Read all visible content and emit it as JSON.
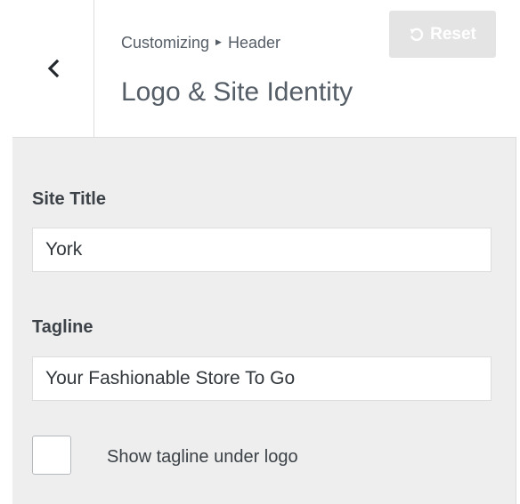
{
  "header": {
    "breadcrumb_root": "Customizing",
    "breadcrumb_current": "Header",
    "section_title": "Logo & Site Identity",
    "reset_label": "Reset"
  },
  "fields": {
    "site_title": {
      "label": "Site Title",
      "value": "York"
    },
    "tagline": {
      "label": "Tagline",
      "value": "Your Fashionable Store To Go"
    },
    "show_tagline": {
      "label": "Show tagline under logo",
      "checked": false
    }
  },
  "icons": {
    "back": "chevron-left-icon",
    "reset": "undo-icon"
  },
  "colors": {
    "panel_background": "#eeeeee",
    "header_background": "#ffffff",
    "text": "#555d66",
    "reset_button": "#e4e4e4"
  }
}
